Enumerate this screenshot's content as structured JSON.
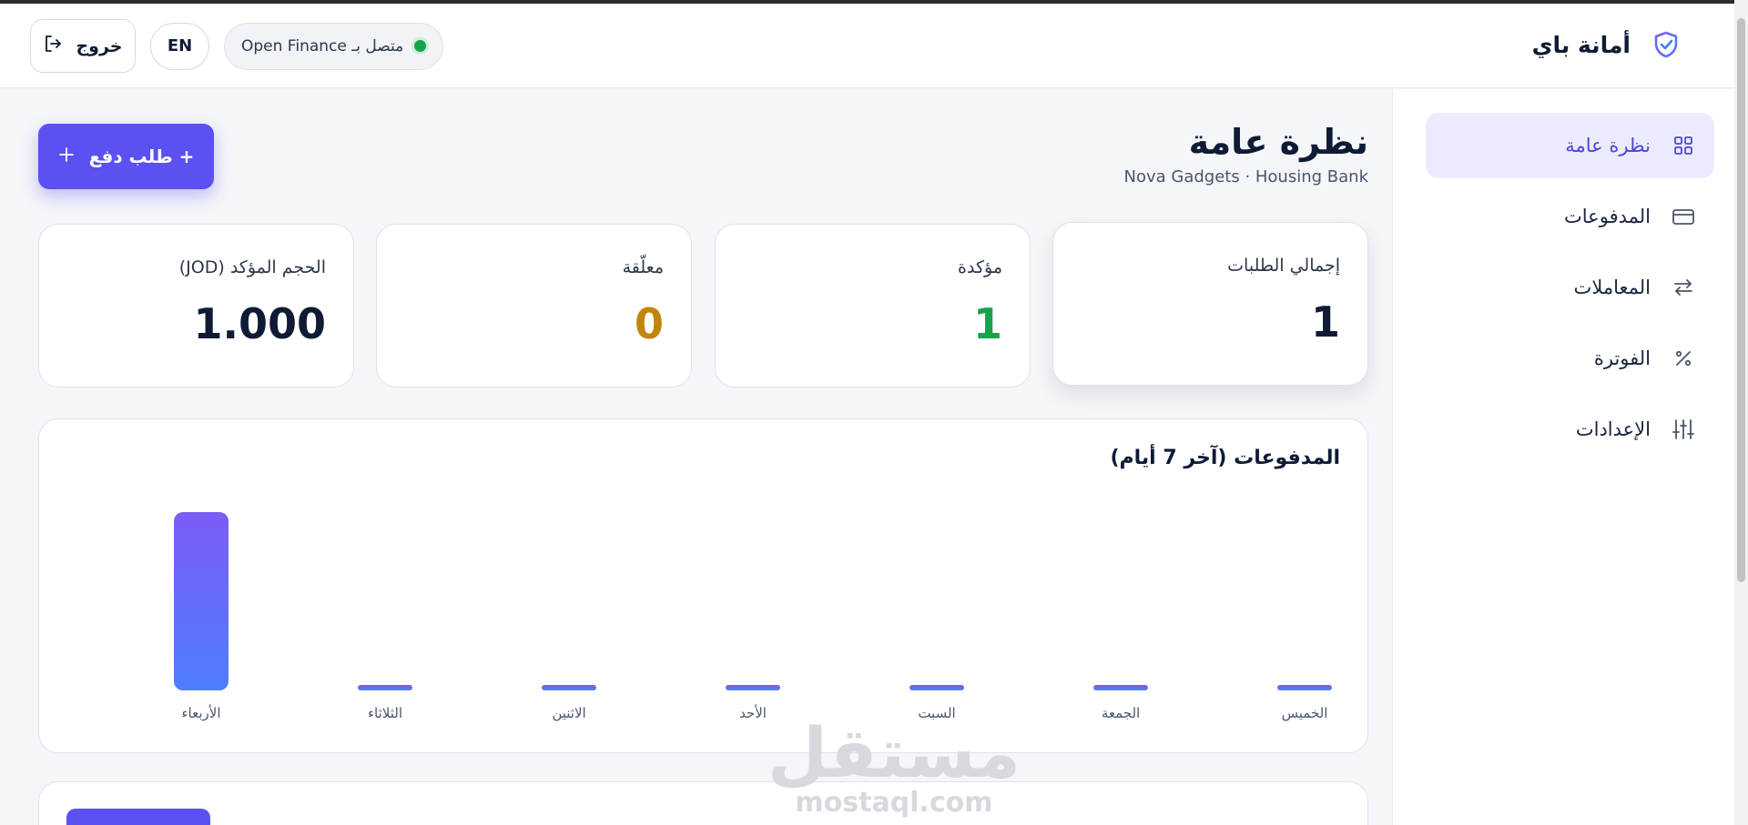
{
  "app": {
    "name": "أمانة باي"
  },
  "header": {
    "logout_label": "خروج",
    "lang_label": "EN",
    "status_text": "متصل بـ Open Finance"
  },
  "sidebar": {
    "items": [
      {
        "label": "نظرة عامة",
        "icon": "grid-icon",
        "active": true
      },
      {
        "label": "المدفوعات",
        "icon": "credit-card-icon",
        "active": false
      },
      {
        "label": "المعاملات",
        "icon": "transfer-arrows-icon",
        "active": false
      },
      {
        "label": "الفوترة",
        "icon": "percent-icon",
        "active": false
      },
      {
        "label": "الإعدادات",
        "icon": "sliders-icon",
        "active": false
      }
    ]
  },
  "page": {
    "title": "نظرة عامة",
    "subtitle": "Nova Gadgets · Housing Bank",
    "new_request_label": "+ طلب دفع"
  },
  "stats": [
    {
      "label": "إجمالي الطلبات",
      "value": "1",
      "color": "#0f1b35"
    },
    {
      "label": "مؤكدة",
      "value": "1",
      "color": "#16a34a"
    },
    {
      "label": "معلّقة",
      "value": "0",
      "color": "#c2850c"
    },
    {
      "label": "الحجم المؤكد (JOD)",
      "value": "1.000",
      "color": "#0f1b35"
    }
  ],
  "chart_data": {
    "type": "bar",
    "title": "المدفوعات (آخر 7 أيام)",
    "categories": [
      "الخميس",
      "الجمعة",
      "السبت",
      "الأحد",
      "الاثنين",
      "الثلاثاء",
      "الأربعاء"
    ],
    "values": [
      0,
      0,
      0,
      0,
      0,
      0,
      1000
    ],
    "xlabel": "",
    "ylabel": "",
    "bar_colors": [
      "#7c5cf5",
      "#4f7dff"
    ]
  },
  "watermark": {
    "ar": "مستقل",
    "en": "mostaql.com"
  },
  "colors": {
    "accent": "#5b50f0",
    "success": "#16a34a",
    "warning": "#c2850c"
  }
}
